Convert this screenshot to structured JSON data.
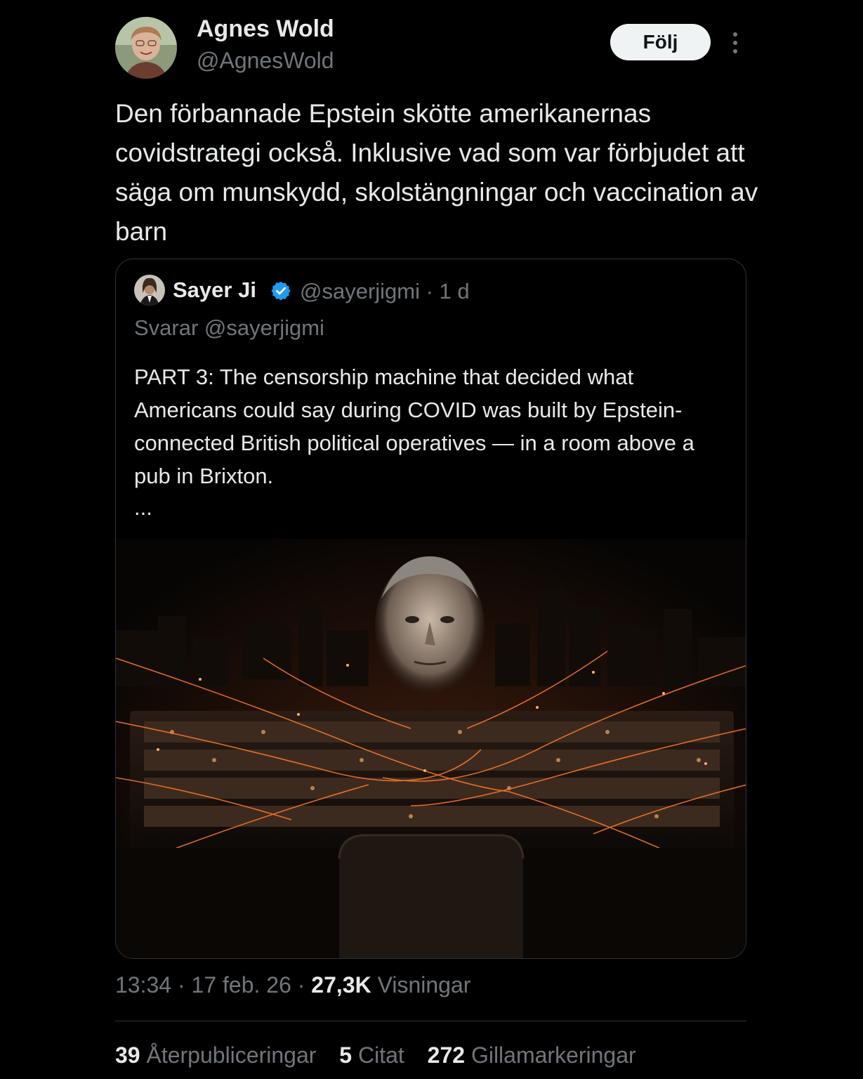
{
  "author": {
    "name": "Agnes Wold",
    "handle": "@AgnesWold",
    "follow_label": "Följ"
  },
  "tweet": {
    "text": "Den förbannade Epstein skötte amerikanernas covidstrategi också. Inklusive vad som var förbjudet att säga om munskydd, skolstängningar och vaccination av barn"
  },
  "quote": {
    "name": "Sayer Ji",
    "handle_time": "@sayerjigmi · 1 d",
    "reply_to": "Svarar @sayerjigmi",
    "text": "PART 3: The censorship machine that decided what Americans could say during COVID was built by Epstein-connected British political operatives — in a room above a pub in Brixton.",
    "ellipsis": "..."
  },
  "meta": {
    "time_date": "13:34 · 17 feb. 26 · ",
    "views_count": "27,3K",
    "views_label": " Visningar"
  },
  "stats": {
    "reposts_count": "39",
    "reposts_label": " Återpubliceringar",
    "quotes_count": "5",
    "quotes_label": " Citat",
    "likes_count": "272",
    "likes_label": " Gillamarkeringar"
  },
  "colors": {
    "background": "#000000",
    "text_primary": "#e7e9ea",
    "text_secondary": "#71767b",
    "verified": "#1d9bf0",
    "border": "#2f3336"
  }
}
